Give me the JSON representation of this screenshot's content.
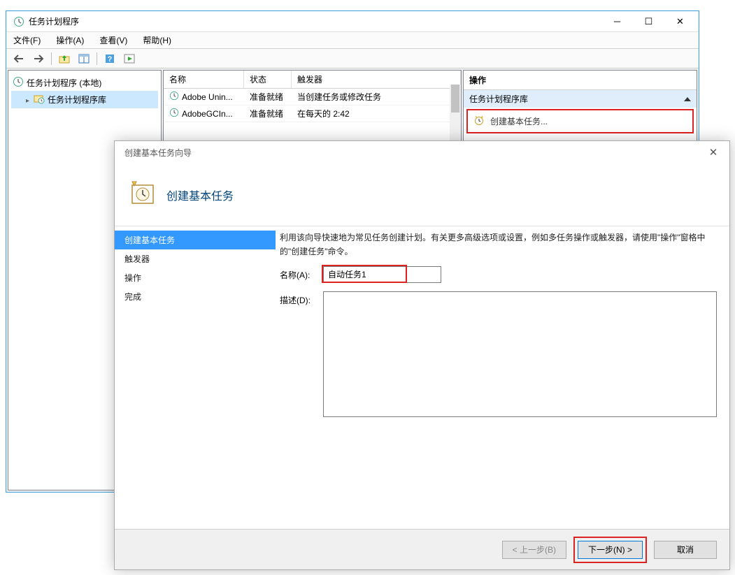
{
  "window": {
    "title": "任务计划程序"
  },
  "menu": {
    "file": "文件(F)",
    "action": "操作(A)",
    "view": "查看(V)",
    "help": "帮助(H)"
  },
  "tree": {
    "root": "任务计划程序 (本地)",
    "lib": "任务计划程序库"
  },
  "task_list": {
    "headers": {
      "name": "名称",
      "status": "状态",
      "trigger": "触发器"
    },
    "rows": [
      {
        "name": "Adobe Unin...",
        "status": "准备就绪",
        "trigger": "当创建任务或修改任务"
      },
      {
        "name": "AdobeGCIn...",
        "status": "准备就绪",
        "trigger": "在每天的 2:42"
      }
    ]
  },
  "actions_panel": {
    "title": "操作",
    "section": "任务计划程序库",
    "create_basic": "创建基本任务..."
  },
  "wizard": {
    "dialog_title": "创建基本任务向导",
    "header_title": "创建基本任务",
    "steps": {
      "s1": "创建基本任务",
      "s2": "触发器",
      "s3": "操作",
      "s4": "完成"
    },
    "intro": "利用该向导快速地为常见任务创建计划。有关更多高级选项或设置，例如多任务操作或触发器，请使用\"操作\"窗格中的\"创建任务\"命令。",
    "labels": {
      "name": "名称(A):",
      "desc": "描述(D):"
    },
    "name_value": "自动任务1",
    "buttons": {
      "back": "< 上一步(B)",
      "next": "下一步(N) >",
      "cancel": "取消"
    }
  }
}
